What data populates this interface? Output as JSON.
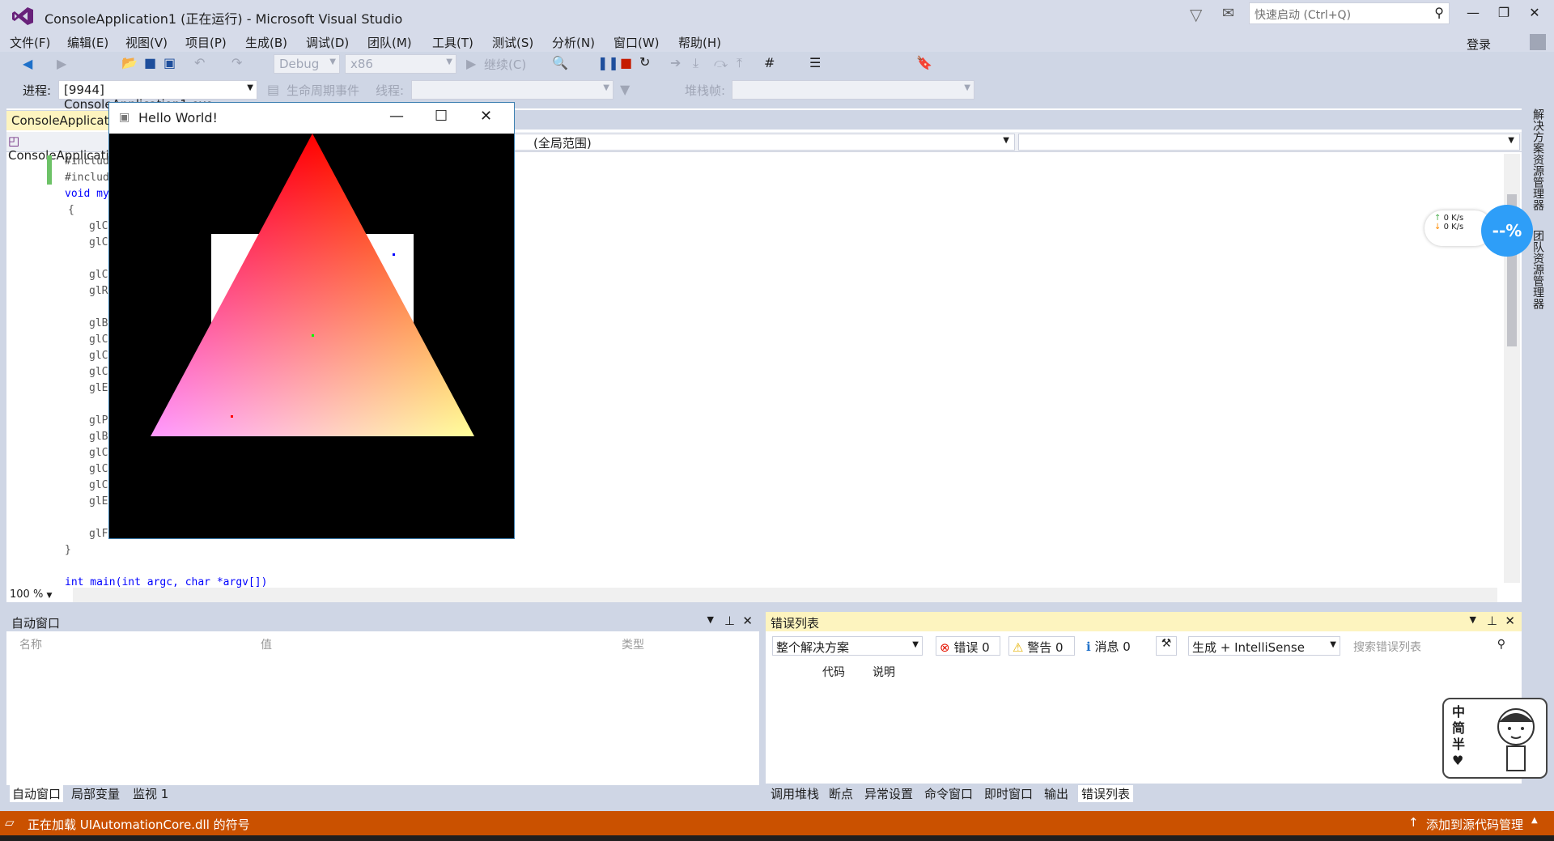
{
  "window": {
    "title": "ConsoleApplication1 (正在运行) - Microsoft Visual Studio",
    "quick_launch_placeholder": "快速启动 (Ctrl+Q)",
    "login": "登录"
  },
  "menu": [
    "文件(F)",
    "编辑(E)",
    "视图(V)",
    "项目(P)",
    "生成(B)",
    "调试(D)",
    "团队(M)",
    "工具(T)",
    "测试(S)",
    "分析(N)",
    "窗口(W)",
    "帮助(H)"
  ],
  "toolbar1": {
    "config": "Debug",
    "platform": "x86",
    "continue": "继续(C)"
  },
  "toolbar2": {
    "process_label": "进程:",
    "process_value": "[9944] ConsoleApplication1.exe",
    "lifecycle": "生命周期事件",
    "thread_label": "线程:",
    "stack_label": "堆栈帧:"
  },
  "editor": {
    "tab": "ConsoleApplication1",
    "nav_left": "ConsoleApplication1",
    "nav_mid": "(全局范围)",
    "zoom": "100 %",
    "lines": [
      "#includ",
      "#includ",
      "void my",
      "{",
      "glC",
      "glC",
      "",
      "glC",
      "glR",
      "",
      "glB",
      "glC",
      "glC",
      "glC",
      "glE",
      "",
      "glP",
      "glB",
      "glC",
      "glC",
      "glC",
      "glE",
      "",
      "glF",
      "}",
      "",
      "int main(int argc, char *argv[])"
    ]
  },
  "side_tabs": [
    "解决方案资源管理器",
    "团队资源管理器"
  ],
  "net": {
    "up": "0 K/s",
    "down": "0 K/s",
    "ball": "--%"
  },
  "hello": {
    "title": "Hello World!"
  },
  "auto_pane": {
    "title": "自动窗口",
    "cols": [
      "名称",
      "值",
      "类型"
    ],
    "tabs": [
      "自动窗口",
      "局部变量",
      "监视 1"
    ]
  },
  "error_pane": {
    "title": "错误列表",
    "scope": "整个解决方案",
    "errors": "错误 0",
    "warnings": "警告 0",
    "messages": "消息 0",
    "build": "生成 + IntelliSense",
    "search_placeholder": "搜索错误列表",
    "cols": [
      "代码",
      "说明"
    ],
    "tabs": [
      "调用堆栈",
      "断点",
      "异常设置",
      "命令窗口",
      "即时窗口",
      "输出",
      "错误列表"
    ]
  },
  "sticker": {
    "text": [
      "中",
      "简",
      "半"
    ]
  },
  "status": {
    "left": "正在加载 UIAutomationCore.dll 的符号",
    "right": "添加到源代码管理"
  },
  "colors": {
    "accent": "#ca5100",
    "error_pane_header": "#fdf4bf",
    "net_ball": "#2e9ef8"
  }
}
